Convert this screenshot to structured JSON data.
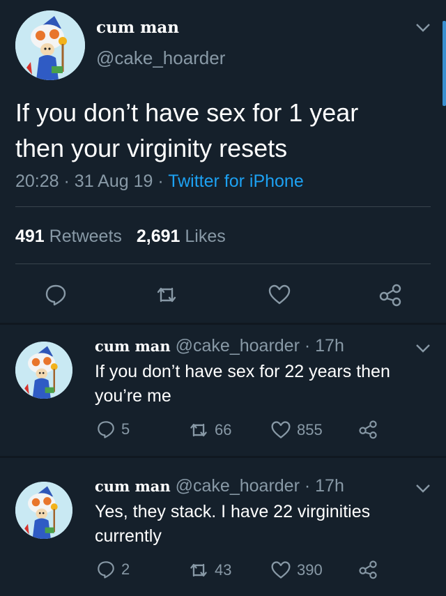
{
  "main_tweet": {
    "display_name": "cum man",
    "handle": "@cake_hoarder",
    "text_line1": "If you don’t have sex for 1 year",
    "text_line2": "then your virginity resets",
    "time": "20:28",
    "date": "31 Aug 19",
    "client": "Twitter for iPhone",
    "retweets_count": "491",
    "retweets_label": "Retweets",
    "likes_count": "2,691",
    "likes_label": "Likes"
  },
  "replies": [
    {
      "display_name": "cum man",
      "handle": "@cake_hoarder",
      "age": "17h",
      "text_line1": "If you don’t have sex for 22 years then",
      "text_line2": "you’re me",
      "replies": "5",
      "retweets": "66",
      "likes": "855"
    },
    {
      "display_name": "cum man",
      "handle": "@cake_hoarder",
      "age": "17h",
      "text_line1": "Yes, they stack. I have 22 virginities",
      "text_line2": "currently",
      "replies": "2",
      "retweets": "43",
      "likes": "390"
    }
  ],
  "separator": "·",
  "colors": {
    "background": "#15202b",
    "secondary_text": "#8899a6",
    "link": "#1da1f2",
    "divider": "#38444d"
  },
  "icons": [
    "chevron-down-icon",
    "reply-icon",
    "retweet-icon",
    "like-icon",
    "share-icon"
  ]
}
